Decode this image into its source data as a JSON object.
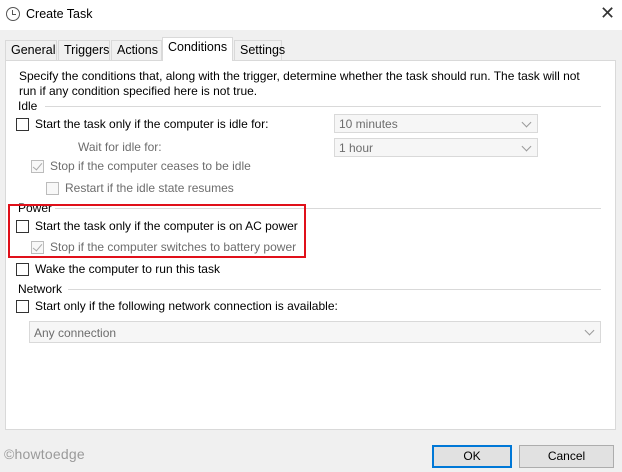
{
  "window": {
    "title": "Create Task",
    "app_icon": "clock-icon",
    "close_glyph": "✕"
  },
  "tabs": [
    {
      "label": "General",
      "active": false
    },
    {
      "label": "Triggers",
      "active": false
    },
    {
      "label": "Actions",
      "active": false
    },
    {
      "label": "Conditions",
      "active": true
    },
    {
      "label": "Settings",
      "active": false
    }
  ],
  "description": "Specify the conditions that, along with the trigger, determine whether the task should run.  The task will not run  if any condition specified here is not true.",
  "idle": {
    "group_label": "Idle",
    "start_if_idle": {
      "label": "Start the task only if the computer is idle for:",
      "checked": false
    },
    "idle_duration": "10 minutes",
    "wait_label": "Wait for idle for:",
    "wait_duration": "1 hour",
    "stop_if_not_idle": {
      "label": "Stop if the computer ceases to be idle",
      "checked": true,
      "enabled": false
    },
    "restart_if_idle": {
      "label": "Restart if the idle state resumes",
      "checked": false,
      "enabled": false
    }
  },
  "power": {
    "group_label": "Power",
    "ac_power": {
      "label": "Start the task only if the computer is on AC power",
      "checked": false
    },
    "battery_stop": {
      "label": "Stop if the computer switches to battery power",
      "checked": true,
      "enabled": false
    },
    "wake": {
      "label": "Wake the computer to run this task",
      "checked": false
    }
  },
  "network": {
    "group_label": "Network",
    "start_if_network": {
      "label": "Start only if the following network connection is available:",
      "checked": false
    },
    "connection": "Any connection"
  },
  "buttons": {
    "ok": "OK",
    "cancel": "Cancel"
  },
  "watermark": "©howtoedge",
  "colors": {
    "highlight": "#e0101a",
    "default_button_border": "#0078d7"
  }
}
